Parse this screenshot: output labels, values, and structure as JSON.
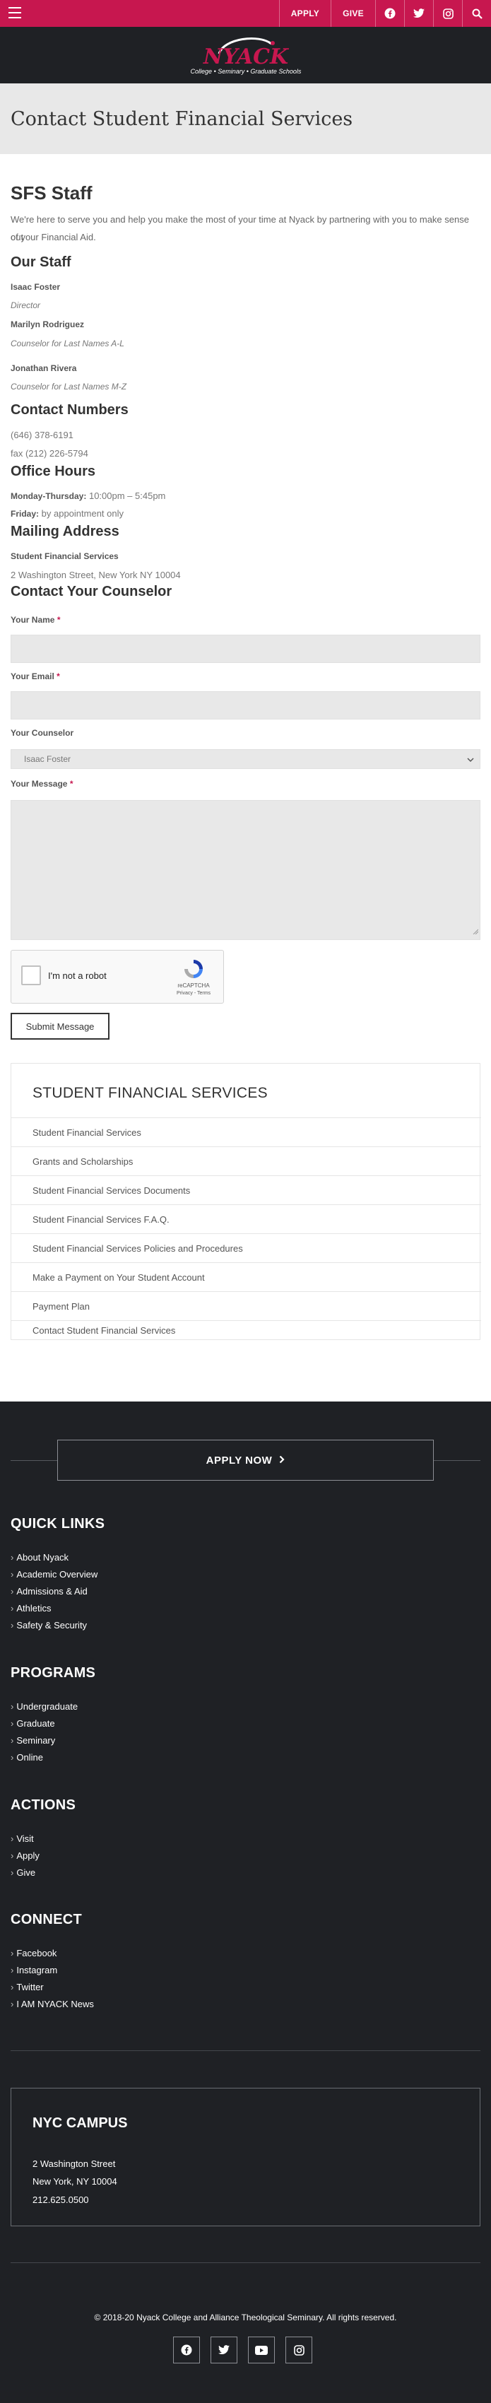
{
  "topbar": {
    "apply_label": "APPLY",
    "give_label": "GIVE",
    "icons": [
      "menu-icon",
      "facebook-icon",
      "twitter-icon",
      "instagram-icon",
      "search-icon"
    ]
  },
  "brand": {
    "logo_text": "NYACK",
    "logo_tagline": "College • Seminary • Graduate Schools",
    "primary_color": "#c7174f",
    "dark_color": "#1f2125"
  },
  "page": {
    "title": "Contact Student Financial Services"
  },
  "intro": {
    "heading": "SFS Staff",
    "text_line1": "We're here to serve you and help you make the most of your time at Nyack by partnering with you to make sense out",
    "text_line2": "of your Financial Aid."
  },
  "staff": {
    "heading": "Our Staff",
    "members": [
      {
        "name": "Isaac Foster",
        "role": "Director"
      },
      {
        "name": "Marilyn Rodriguez",
        "role": "Counselor for Last Names A-L"
      },
      {
        "name": "Jonathan Rivera",
        "role": "Counselor for Last Names M-Z"
      }
    ]
  },
  "contact_numbers": {
    "heading": "Contact Numbers",
    "phone": "(646) 378-6191",
    "fax": "fax (212) 226-5794"
  },
  "office_hours": {
    "heading": "Office Hours",
    "weekday_label": "Monday-Thursday:",
    "weekday_value": "10:00pm – 5:45pm",
    "friday_label": "Friday:",
    "friday_value": "by appointment only"
  },
  "mailing": {
    "heading": "Mailing Address",
    "name": "Student Financial Services",
    "address": "2 Washington Street, New York NY 10004"
  },
  "form": {
    "heading": "Contact Your Counselor",
    "name_label": "Your Name",
    "email_label": "Your Email",
    "counselor_label": "Your Counselor",
    "counselor_selected": "Isaac Foster",
    "message_label": "Your Message",
    "required_mark": "*",
    "recaptcha_label": "I'm not a robot",
    "recaptcha_brand": "reCAPTCHA",
    "recaptcha_links": "Privacy - Terms",
    "submit_label": "Submit Message"
  },
  "sfs_nav": {
    "title": "STUDENT FINANCIAL SERVICES",
    "items": [
      "Student Financial Services",
      "Grants and Scholarships",
      "Student Financial Services Documents",
      "Student Financial Services F.A.Q.",
      "Student Financial Services Policies and Procedures",
      "Make a Payment on Your Student Account",
      "Payment Plan",
      "Contact Student Financial Services"
    ]
  },
  "footer": {
    "apply_now_label": "APPLY NOW",
    "quick_links": {
      "heading": "QUICK LINKS",
      "items": [
        "About Nyack",
        "Academic Overview",
        "Admissions & Aid",
        "Athletics",
        "Safety & Security"
      ]
    },
    "programs": {
      "heading": "PROGRAMS",
      "items": [
        "Undergraduate",
        "Graduate",
        "Seminary",
        "Online"
      ]
    },
    "actions": {
      "heading": "ACTIONS",
      "items": [
        "Visit",
        "Apply",
        "Give"
      ]
    },
    "connect": {
      "heading": "CONNECT",
      "items": [
        "Facebook",
        "Instagram",
        "Twitter",
        "I AM NYACK News"
      ]
    },
    "campus": {
      "heading": "NYC CAMPUS",
      "street": "2 Washington Street",
      "city": "New York, NY 10004",
      "phone": "212.625.0500"
    },
    "copyright": "© 2018-20 Nyack College and Alliance Theological Seminary. All rights reserved.",
    "social_icons": [
      "facebook-icon",
      "twitter-icon",
      "youtube-icon",
      "instagram-icon"
    ]
  }
}
